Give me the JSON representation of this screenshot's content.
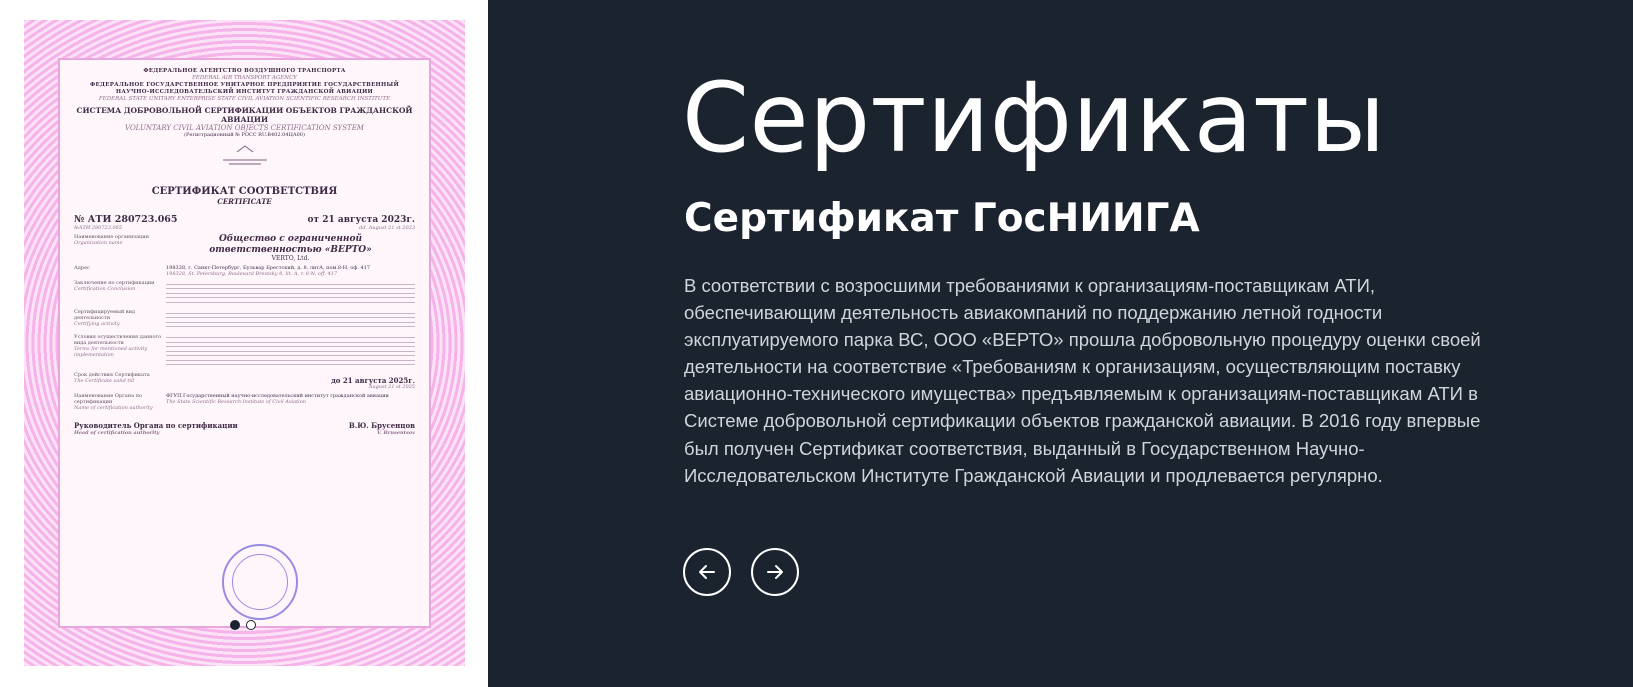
{
  "page": {
    "title": "Сертификаты",
    "certificate_heading": "Сертификат ГосНИИГА",
    "description": "В соответствии с возросшими требованиями к организациям-поставщикам АТИ, обеспечивающим деятельность авиакомпаний по поддержанию летной годности эксплуатируемого парка ВС, ООО «ВЕРТО» прошла добровольную процедуру оценки своей деятельности на соответствие «Требованиям к организациям, осуществляющим поставку авиационно-технического имущества» предъявляемым к организациям-поставщикам АТИ в Системе добровольной сертификации объектов гражданской авиации. В 2016 году впервые был получен Сертификат соответствия, выданный в Государственном Научно-Исследовательском Институте Гражданской Авиации и продлевается регулярно."
  },
  "slider": {
    "current": 1,
    "total": 2,
    "prev_icon": "arrow-left-icon",
    "next_icon": "arrow-right-icon"
  },
  "certificate_image": {
    "agency": "ФЕДЕРАЛЬНОЕ АГЕНТСТВО ВОЗДУШНОГО ТРАНСПОРТА",
    "agency_en": "FEDERAL AIR TRANSPORT AGENCY",
    "institute": "ФЕДЕРАЛЬНОЕ ГОСУДАРСТВЕННОЕ УНИТАРНОЕ ПРЕДПРИЯТИЕ ГОСУДАРСТВЕННЫЙ НАУЧНО-ИССЛЕДОВАТЕЛЬСКИЙ ИНСТИТУТ ГРАЖДАНСКОЙ АВИАЦИИ",
    "institute_en": "FEDERAL STATE UNITARY ENTERPRISE STATE CIVIL AVIATION SCIENTIFIC RESEARCH INSTITUTE",
    "system": "СИСТЕМА ДОБРОВОЛЬНОЙ СЕРТИФИКАЦИИ ОБЪЕКТОВ ГРАЖДАНСКОЙ АВИАЦИИ",
    "system_en": "VOLUNTARY CIVIL AVIATION OBJECTS CERTIFICATION SYSTEM",
    "registration": "(Регистрационный № РОСС RU.В402.04ЦА00)",
    "title": "СЕРТИФИКАТ СООТВЕТСТВИЯ",
    "title_en": "CERTIFICATE",
    "number": "№ АТИ 280723.065",
    "number_en": "№АТИ 280723.065",
    "date": "от 21 августа 2023г.",
    "date_en": "dd. August 21 st 2023",
    "org_label": "Наименование организации",
    "org_label_en": "Organization name",
    "org_name": "Общество с ограниченной ответственностью «ВЕРТО»",
    "org_name_en": "VERTO, Ltd.",
    "address_label": "Адрес",
    "address": "198328, г. Санкт-Петербург, Бульвар Брестский, д. 8, литА, пом.8-Н, оф. 417",
    "address_en": "198328, St. Petersburg, Boulevard Brestsky 8, lit. A, r. 8-N, off. 417",
    "conclusion_label": "Заключение по сертификации",
    "conclusion_label_en": "Certification Conclusion",
    "activity_label": "Сертифицируемый вид деятельности",
    "activity_label_en": "Certifying activity",
    "conditions_label": "Условия осуществления данного вида деятельности",
    "terms_label": "Terms for mentioned activity implementation",
    "validity_label": "Срок действия Сертификата",
    "validity_label_en": "The Certificate valid till",
    "valid_until": "до 21 августа 2025г.",
    "valid_until_en": "August 21 st 2025",
    "authority_label": "Наименование Органа по сертификации",
    "authority_label_en": "Name of certification authority",
    "authority": "ФГУП Государственный научно-исследовательский институт гражданской авиации",
    "authority_en": "The State Scientific Research Institute of Civil Aviation",
    "head_label": "Руководитель Органа по сертификации",
    "head_label_en": "Head of certification authority",
    "signatory": "В.Ю. Брусенцов",
    "signatory_en": "V. Brusentsov"
  }
}
